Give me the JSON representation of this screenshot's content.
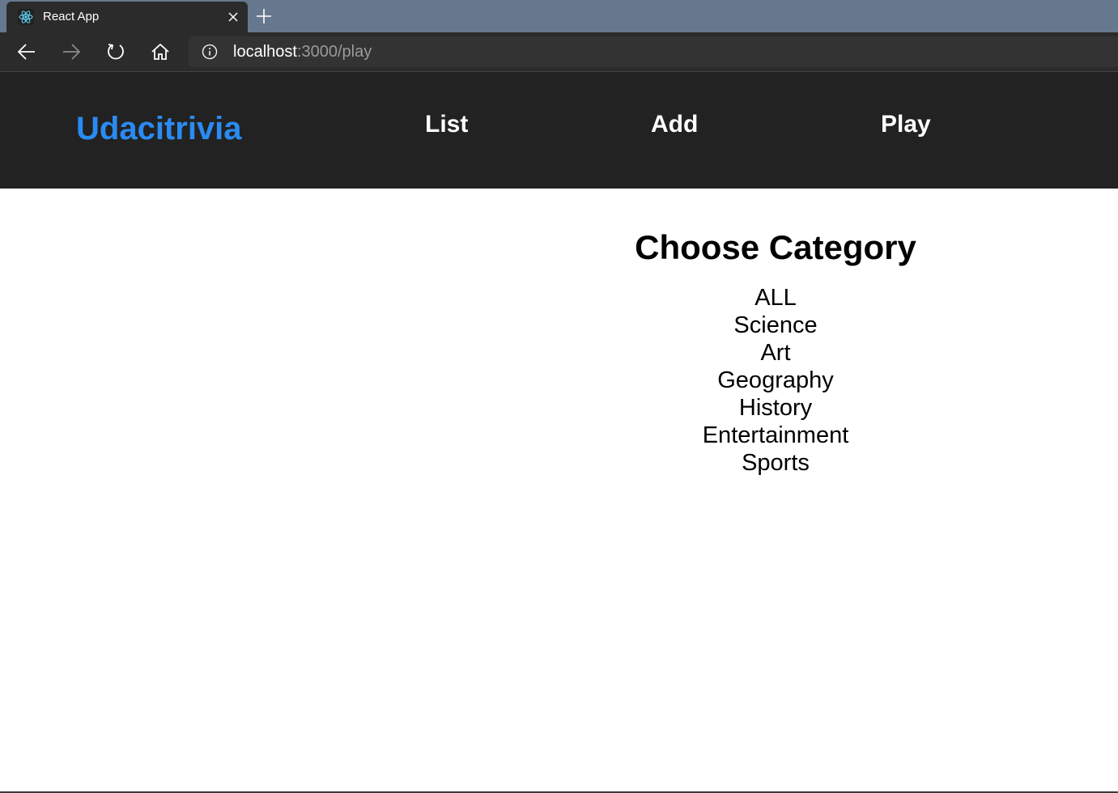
{
  "browser": {
    "tab": {
      "title": "React App",
      "favicon_icon": "react-logo-icon",
      "close_icon": "close-icon"
    },
    "new_tab_icon": "plus-icon",
    "nav": {
      "back_icon": "arrow-left-icon",
      "forward_icon": "arrow-right-icon",
      "reload_icon": "reload-icon",
      "home_icon": "home-icon"
    },
    "address": {
      "info_icon": "info-icon",
      "host": "localhost",
      "path": ":3000/play"
    },
    "colors": {
      "tabstrip": "#66788d",
      "toolbar": "#2b2b2b",
      "address_bar": "#333333"
    }
  },
  "app": {
    "header": {
      "brand": "Udacitrivia",
      "links": [
        "List",
        "Add",
        "Play"
      ],
      "colors": {
        "background": "#222222",
        "brand": "#2a8bf2",
        "link": "#ffffff"
      }
    },
    "play": {
      "title": "Choose Category",
      "categories": [
        "ALL",
        "Science",
        "Art",
        "Geography",
        "History",
        "Entertainment",
        "Sports"
      ]
    }
  }
}
